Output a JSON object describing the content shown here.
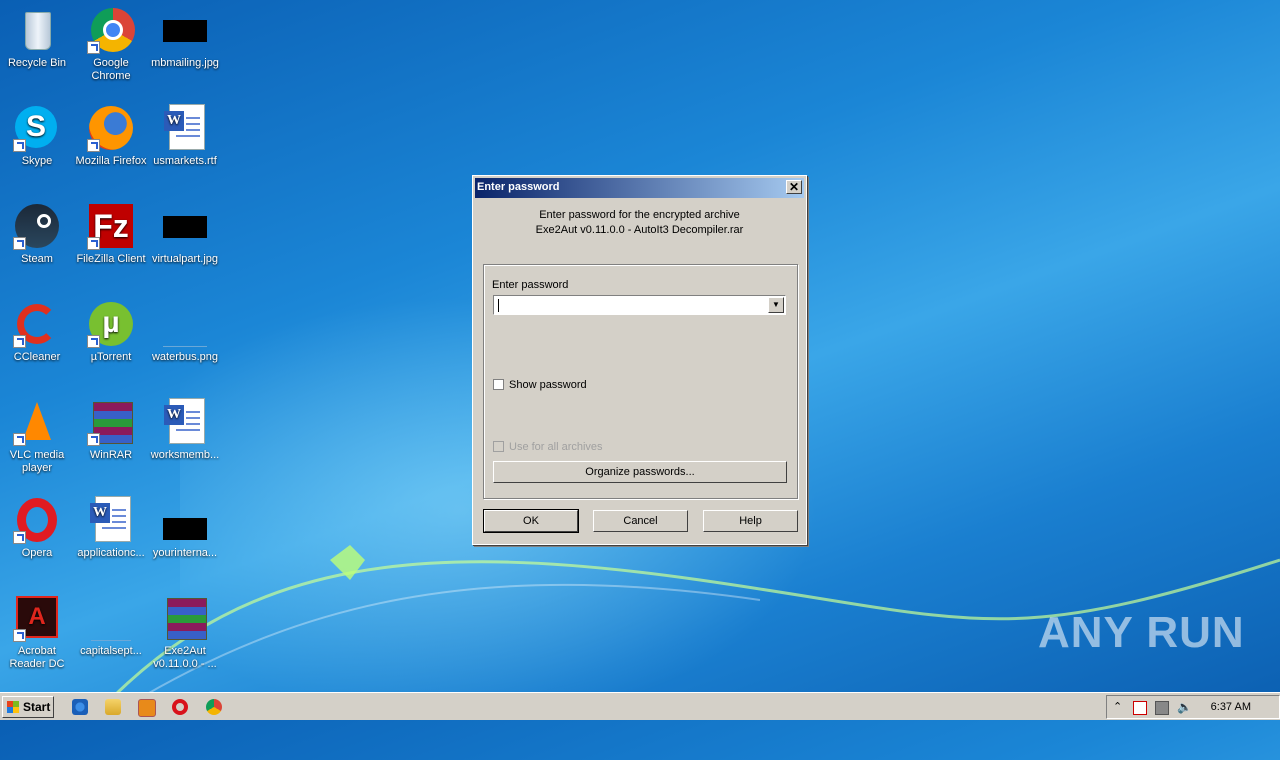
{
  "desktop": {
    "icons": [
      {
        "label": "Recycle Bin"
      },
      {
        "label": "Google Chrome"
      },
      {
        "label": "mbmailing.jpg"
      },
      {
        "label": "Skype"
      },
      {
        "label": "Mozilla Firefox"
      },
      {
        "label": "usmarkets.rtf"
      },
      {
        "label": "Steam"
      },
      {
        "label": "FileZilla Client"
      },
      {
        "label": "virtualpart.jpg"
      },
      {
        "label": "CCleaner"
      },
      {
        "label": "µTorrent"
      },
      {
        "label": "waterbus.png"
      },
      {
        "label": "VLC media player"
      },
      {
        "label": "WinRAR"
      },
      {
        "label": "worksmemb..."
      },
      {
        "label": "Opera"
      },
      {
        "label": "applicationc..."
      },
      {
        "label": "yourinterna..."
      },
      {
        "label": "Acrobat Reader DC"
      },
      {
        "label": "capitalsept..."
      },
      {
        "label": "Exe2Aut v0.11.0.0 - ..."
      }
    ]
  },
  "dialog": {
    "title": "Enter password",
    "message_line1": "Enter password for the encrypted archive",
    "message_line2": "Exe2Aut v0.11.0.0 - AutoIt3 Decompiler.rar",
    "field_label": "Enter password",
    "password_value": "",
    "show_password_label": "Show password",
    "use_for_all_label": "Use for all archives",
    "organize_label": "Organize passwords...",
    "ok_label": "OK",
    "cancel_label": "Cancel",
    "help_label": "Help"
  },
  "taskbar": {
    "start_label": "Start",
    "clock": "6:37 AM"
  },
  "watermark": "ANY RUN"
}
